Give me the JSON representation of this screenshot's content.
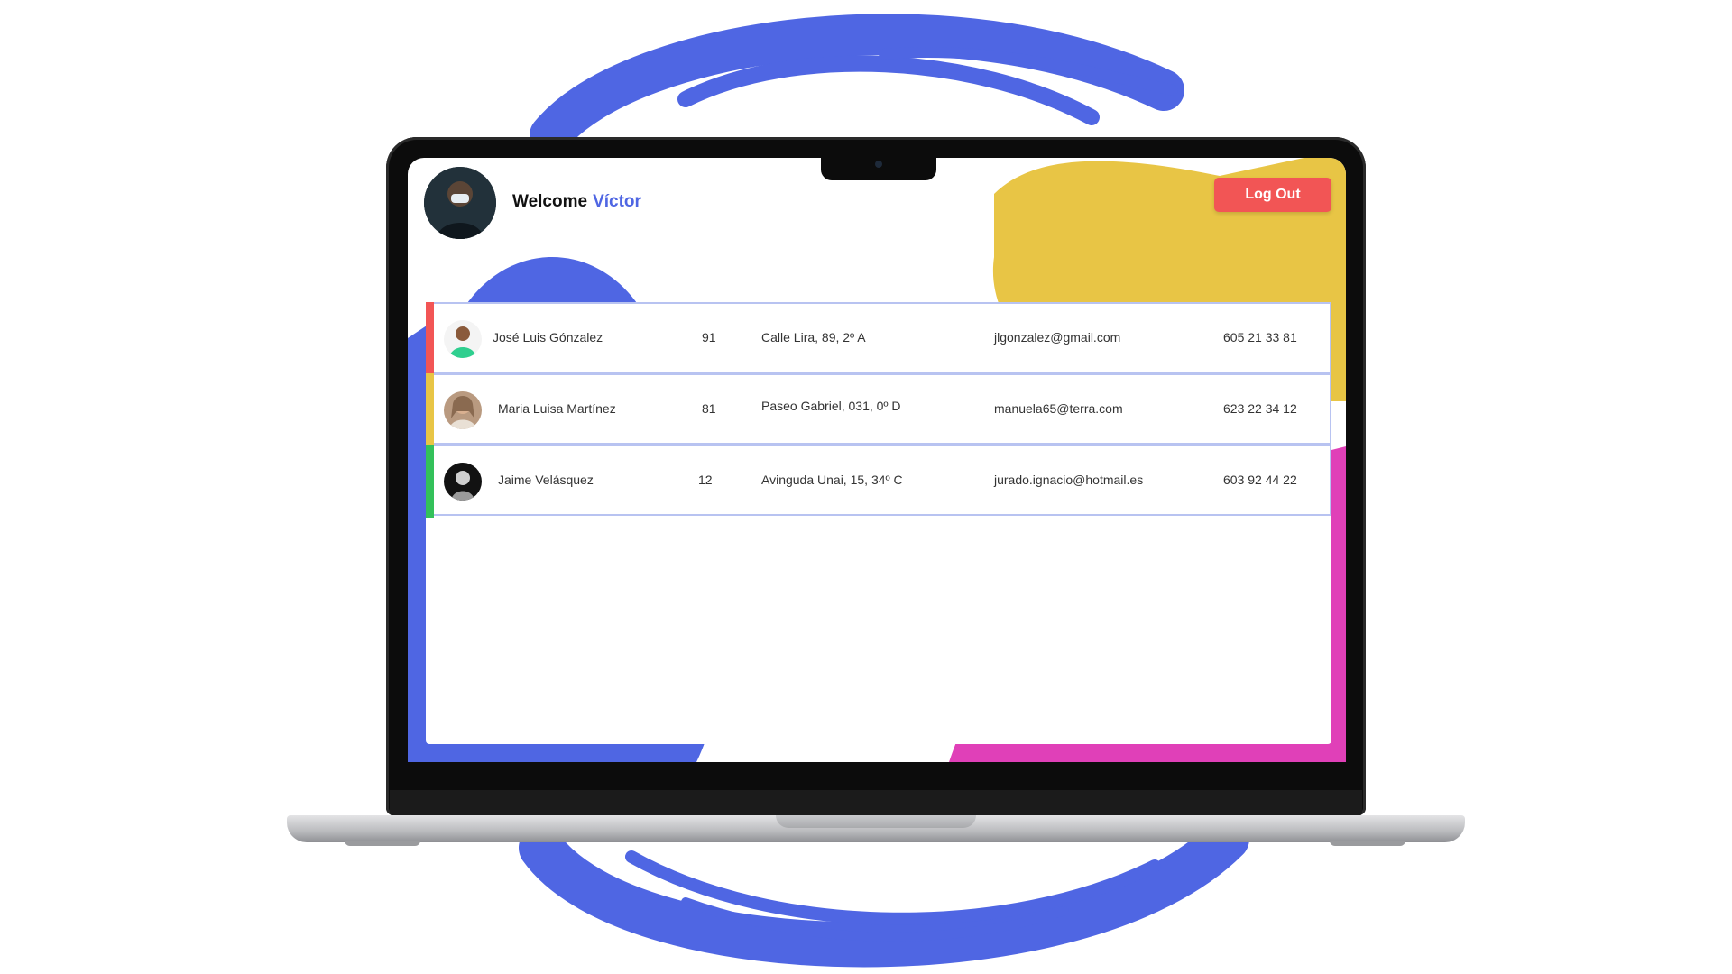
{
  "header": {
    "welcome_label": "Welcome",
    "user_name": "Víctor",
    "logout_label": "Log Out"
  },
  "users": [
    {
      "name": "José Luis Gónzalez",
      "age": "91",
      "address": "Calle Lira, 89, 2º A",
      "email": "jlgonzalez@gmail.com",
      "phone": "605 21 33 81",
      "accent": "#f25555"
    },
    {
      "name": "Maria Luisa Martínez",
      "age": "81",
      "address": "Paseo Gabriel, 031, 0º D",
      "email": "manuela65@terra.com",
      "phone": "623 22 34 12",
      "accent": "#e8c545"
    },
    {
      "name": "Jaime Velásquez",
      "age": "12",
      "address": "Avinguda Unai, 15, 34º C",
      "email": "jurado.ignacio@hotmail.es",
      "phone": "603 92 44 22",
      "accent": "#33c15a"
    }
  ],
  "colors": {
    "brand_blue": "#4f66e3",
    "yellow": "#e8c545",
    "magenta": "#e040b8",
    "logout_red": "#f25555"
  },
  "icons": {
    "background": "blue-brush-swirl",
    "user_avatar": "user-photo"
  }
}
